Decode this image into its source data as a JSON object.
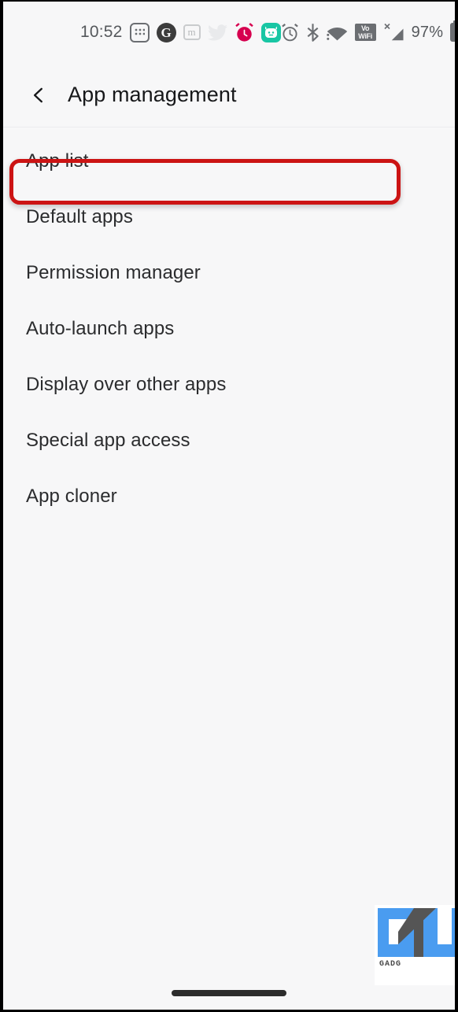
{
  "statusbar": {
    "time": "10:52",
    "battery_percent": "97%",
    "left_icons": [
      {
        "name": "calculator-icon",
        "label": "Calculator"
      },
      {
        "name": "groww-icon",
        "label": "G"
      },
      {
        "name": "medium-icon",
        "label": "m"
      },
      {
        "name": "twitter-icon",
        "label": "Twitter"
      },
      {
        "name": "alarm-notification-icon",
        "label": "Alarm"
      },
      {
        "name": "mi-home-icon",
        "label": "Mi Home"
      }
    ],
    "right_icons": [
      {
        "name": "alarm-set-icon",
        "label": "Alarm set"
      },
      {
        "name": "bluetooth-icon",
        "label": "Bluetooth"
      },
      {
        "name": "wifi-icon",
        "label": "Wi-Fi"
      },
      {
        "name": "vowifi-icon",
        "label": "VoWiFi"
      },
      {
        "name": "no-sim-signal-icon",
        "label": "No SIM"
      },
      {
        "name": "battery-icon",
        "label": "Battery"
      }
    ],
    "vowifi_line1": "Vo",
    "vowifi_line2": "WiFi",
    "no_sim_mark": "X"
  },
  "appbar": {
    "back_label": "Back",
    "title": "App management"
  },
  "list": {
    "items": [
      {
        "label": "App list",
        "name": "settings-row-app-list",
        "highlighted": true
      },
      {
        "label": "Default apps",
        "name": "settings-row-default-apps",
        "highlighted": false
      },
      {
        "label": "Permission manager",
        "name": "settings-row-permission-manager",
        "highlighted": false
      },
      {
        "label": "Auto-launch apps",
        "name": "settings-row-auto-launch-apps",
        "highlighted": false
      },
      {
        "label": "Display over other apps",
        "name": "settings-row-display-over-other-apps",
        "highlighted": false
      },
      {
        "label": "Special app access",
        "name": "settings-row-special-app-access",
        "highlighted": false
      },
      {
        "label": "App cloner",
        "name": "settings-row-app-cloner",
        "highlighted": false
      }
    ]
  },
  "annotation": {
    "highlight_color": "#cc1414",
    "highlight_target": "App list"
  },
  "watermark": {
    "logo_text": "GU",
    "caption": "GADG",
    "blue": "#4a9cf0",
    "gray": "#555555"
  },
  "colors": {
    "background": "#f7f7f8",
    "text_primary": "#2b2c2e",
    "text_title": "#17181a",
    "status_icon": "#6b6e72",
    "accent_red": "#cc1414",
    "mi_teal": "#19c6a4",
    "alarm_crimson": "#d6004f"
  }
}
